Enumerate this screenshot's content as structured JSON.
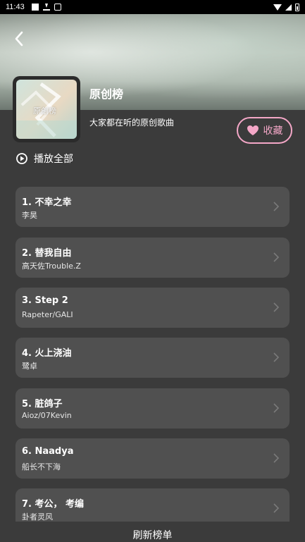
{
  "status_bar": {
    "time": "11:43"
  },
  "header": {
    "back_icon": "chevron-left-icon",
    "title": "原创榜",
    "cover_label": "原创榜",
    "description": "大家都在听的原创歌曲"
  },
  "favorite": {
    "label": "收藏",
    "icon": "heart-icon",
    "color": "#f4a7c7"
  },
  "play_all": {
    "label": "播放全部",
    "icon": "play-circle-icon"
  },
  "songs": [
    {
      "title": "1. 不幸之幸",
      "artist": "李昊"
    },
    {
      "title": "2. 替我自由",
      "artist": "高天佐Trouble.Z"
    },
    {
      "title": "3. Step 2",
      "artist": "Rapeter/GALI"
    },
    {
      "title": "4. 火上浇油",
      "artist": "鹭卓"
    },
    {
      "title": "5. 脏鸽子",
      "artist": "Aioz/07Kevin"
    },
    {
      "title": "6. Naadya",
      "artist": "船长不下海"
    },
    {
      "title": "7. 考公， 考编",
      "artist": "卦者灵风"
    }
  ],
  "footer": {
    "refresh_label": "刷新榜单"
  }
}
